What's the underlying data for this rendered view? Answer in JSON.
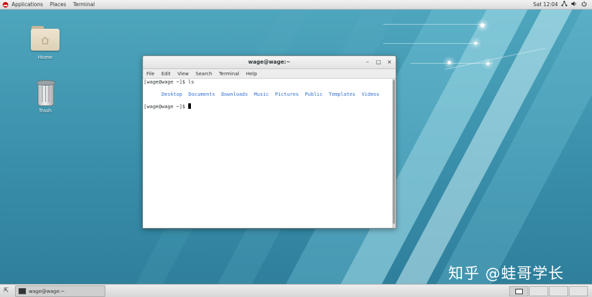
{
  "topbar": {
    "applications": "Applications",
    "places": "Places",
    "terminal": "Terminal",
    "clock": "Sat 12:04"
  },
  "desktop_icons": {
    "home": "Home",
    "trash": "Trash"
  },
  "window": {
    "title": "wage@wage:~",
    "minimize": "–",
    "maximize": "□",
    "close": "×"
  },
  "menubar": {
    "file": "File",
    "edit": "Edit",
    "view": "View",
    "search": "Search",
    "terminal": "Terminal",
    "help": "Help"
  },
  "terminal": {
    "line1": "[wage@wage ~]$ ls",
    "ls_output": [
      "Desktop",
      "Documents",
      "Downloads",
      "Music",
      "Pictures",
      "Public",
      "Templates",
      "Videos"
    ],
    "line3": "[wage@wage ~]$ "
  },
  "taskbar": {
    "window_label": "wage@wage:~"
  },
  "watermark": "知乎 @蛙哥学长",
  "colors": {
    "desktop_bg": "#3f93ab",
    "ls_dir_color": "#2f6ecf",
    "redhat_red": "#cc0000"
  }
}
